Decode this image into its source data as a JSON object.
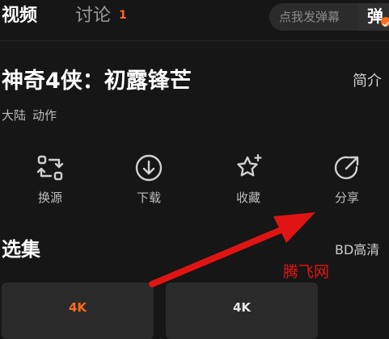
{
  "tabs": {
    "video": "视频",
    "discuss": "讨论",
    "discuss_count": "1"
  },
  "danmu": {
    "placeholder": "点我发弹幕",
    "toggle_label": "弹"
  },
  "title": "神奇4侠：初露锋芒",
  "intro_label": "简介",
  "tags": [
    "大陆",
    "动作"
  ],
  "actions": {
    "source": {
      "label": "换源",
      "icon": "switch-source-icon"
    },
    "download": {
      "label": "下载",
      "icon": "download-icon"
    },
    "favorite": {
      "label": "收藏",
      "icon": "star-icon"
    },
    "share": {
      "label": "分享",
      "icon": "share-icon"
    }
  },
  "episodes": {
    "title": "选集",
    "quality": "BD高清",
    "items": [
      {
        "label": "4K"
      },
      {
        "label": "4K"
      }
    ]
  },
  "watermark": "腾飞网",
  "colors": {
    "background": "#161616",
    "accent": "#ff6a1a",
    "annotation_arrow": "#e11414"
  }
}
